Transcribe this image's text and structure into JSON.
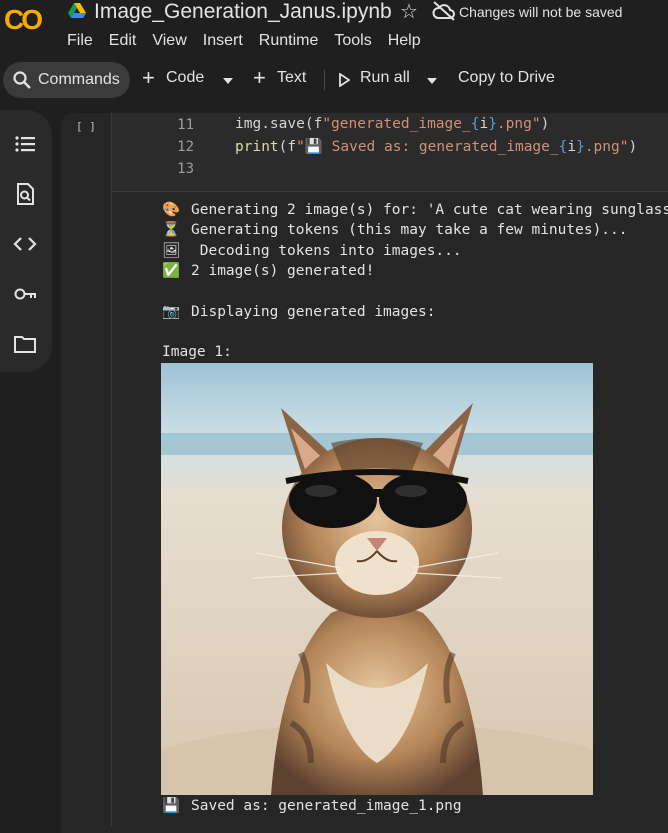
{
  "app": {
    "logo_text": "CO",
    "notebook_title": "Image_Generation_Janus.ipynb",
    "save_status": "Changes will not be saved"
  },
  "menu": [
    "File",
    "Edit",
    "View",
    "Insert",
    "Runtime",
    "Tools",
    "Help"
  ],
  "toolbar": {
    "commands_label": "Commands",
    "code_label": "Code",
    "text_label": "Text",
    "run_all_label": "Run all",
    "copy_label": "Copy to Drive"
  },
  "side_rail_icons": [
    "table-of-contents-icon",
    "find-icon",
    "code-snippets-icon",
    "secrets-key-icon",
    "files-folder-icon"
  ],
  "cell": {
    "run_indicator": "[ ]",
    "lines": [
      {
        "num": "11",
        "text": "img.save(f\"generated_image_{i}.png\")"
      },
      {
        "num": "12",
        "text": "print(f\"💾 Saved as: generated_image_{i}.png\")"
      },
      {
        "num": "13",
        "text": ""
      }
    ]
  },
  "output": {
    "lines": [
      {
        "emoji": "🎨",
        "text": "Generating 2 image(s) for: 'A cute cat wearing sunglass"
      },
      {
        "emoji": "⏳",
        "text": "Generating tokens (this may take a few minutes)..."
      },
      {
        "emoji": "🖼",
        "text": " Decoding tokens into images..."
      },
      {
        "emoji": "✅",
        "text": "2 image(s) generated!"
      },
      {
        "emoji": "📷",
        "text": "Displaying generated images:"
      }
    ],
    "image_label": "Image 1:",
    "saved_emoji": "💾",
    "saved_text": "Saved as: generated_image_1.png"
  },
  "colors": {
    "background": "#1f1f1f",
    "logo": "#f9ab00",
    "string": "#ce9178",
    "text": "#e3e3e3"
  }
}
